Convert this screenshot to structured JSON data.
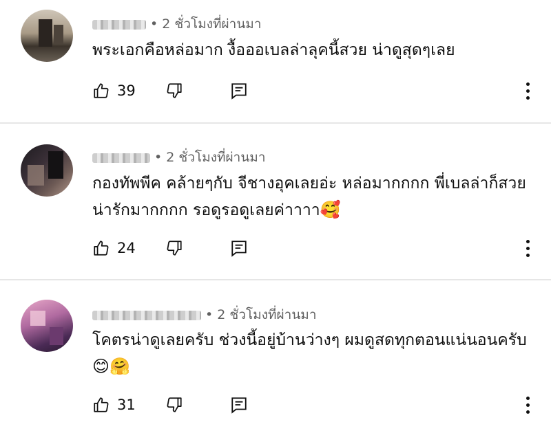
{
  "comments": [
    {
      "time": "• 2 ชั่วโมงที่ผ่านมา",
      "text": "พระเอกคือหล่อมาก งื้อออเบลล่าลุคนี้สวย น่าดูสุดๆเลย",
      "emojis": "",
      "likes": "39"
    },
    {
      "time": "• 2 ชั่วโมงที่ผ่านมา",
      "text": "กองทัพพีค คล้ายๆกับ จีชางอุคเลยอ่ะ หล่อมากกกก พี่เบลล่าก็สวยน่ารักมากกกก รอดูรอดูเลยค่าาาา",
      "emojis": "🥰",
      "likes": "24"
    },
    {
      "time": "• 2 ชั่วโมงที่ผ่านมา",
      "text": "โคตรน่าดูเลยครับ ช่วงนี้อยู่บ้านว่างๆ ผมดูสดทุกตอนแน่นอนครับ",
      "emojis": "😊🤗",
      "likes": "31"
    }
  ],
  "icons": {
    "like": "thumbs-up-icon",
    "dislike": "thumbs-down-icon",
    "reply": "reply-comment-icon",
    "more": "more-vertical-icon"
  }
}
